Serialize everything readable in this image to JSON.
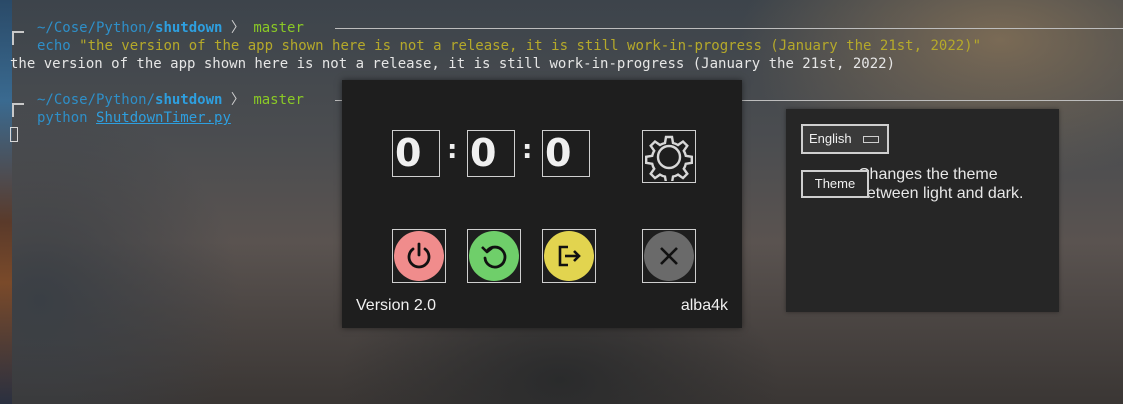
{
  "terminal": {
    "block1": {
      "path_prefix": "~/Cose/Python/",
      "path_dir": "shutdown",
      "separator": "〉",
      "branch": "master",
      "cmd": "echo",
      "cmd_arg": "\"the version of the app shown here is not a release, it is still work-in-progress (January the 21st, 2022)\"",
      "output": "the version of the app shown here is not a release, it is still work-in-progress (January the 21st, 2022)"
    },
    "block2": {
      "path_prefix": "~/Cose/Python/",
      "path_dir": "shutdown",
      "separator": "〉",
      "branch": "master",
      "cmd": "python",
      "cmd_arg": "ShutdownTimer.py"
    }
  },
  "timer": {
    "hours": "0",
    "minutes": "0",
    "seconds": "0",
    "colon": ":",
    "version": "Version 2.0",
    "author": "alba4k",
    "buttons": [
      {
        "name": "shutdown",
        "icon": "power-icon",
        "color": "#f08c8c"
      },
      {
        "name": "restart",
        "icon": "restart-icon",
        "color": "#6fcf6a"
      },
      {
        "name": "logout",
        "icon": "logout-icon",
        "color": "#e2d44f"
      },
      {
        "name": "cancel",
        "icon": "close-icon",
        "color": "#6a6a6a"
      }
    ]
  },
  "settings": {
    "language": "English",
    "theme_button": "Theme",
    "theme_description": "Changes the theme between light and dark."
  }
}
